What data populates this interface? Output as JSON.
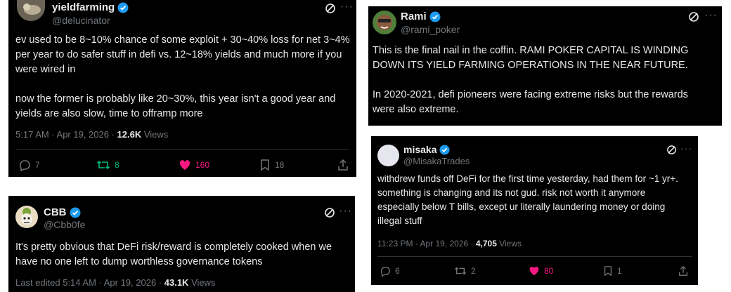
{
  "colors": {
    "background": "#000000",
    "text": "#e7e9ea",
    "muted": "#71767b",
    "verified": "#1d9bf0",
    "retweet": "#00ba7c",
    "like": "#f91880"
  },
  "tweets": [
    {
      "name": "yieldfarming",
      "handle": "@delucinator",
      "paragraphs": [
        "ev used to be 8~10% chance of some exploit + 30~40% loss for net 3~4% per year to do safer stuff in defi vs. 12~18% yields and much more if you were wired in",
        "now the former is probably like 20~30%, this year isn't a good year and yields are also slow, time to offramp more"
      ],
      "time": "5:17 AM · Apr 19, 2026 · ",
      "views_count": "12.6K",
      "views_label": " Views",
      "replies": "7",
      "retweets": "8",
      "likes": "160",
      "bookmarks": "18"
    },
    {
      "name": "CBB",
      "handle": "@Cbb0fe",
      "paragraphs": [
        "It's pretty obvious that DeFi risk/reward is completely cooked when we have no one left to dump worthless governance tokens"
      ],
      "time": "Last edited 5:14 AM · Apr 19, 2026 · ",
      "views_count": "43.1K",
      "views_label": " Views"
    },
    {
      "name": "Rami",
      "handle": "@rami_poker",
      "paragraphs": [
        "This is the final nail in the coffin. RAMI POKER CAPITAL IS WINDING DOWN ITS YIELD FARMING OPERATIONS IN THE NEAR FUTURE.",
        "In 2020-2021, defi pioneers were facing extreme risks but the rewards were also extreme."
      ]
    },
    {
      "name": "misaka",
      "handle": "@MisakaTrades",
      "paragraphs": [
        "withdrew funds off DeFi for the first time yesterday, had them for ~1 yr+. something is changing and its not gud. risk not worth it anymore especially below T bills, except ur literally laundering money or doing illegal stuff"
      ],
      "time": "11:23 PM · Apr 19, 2026 · ",
      "views_count": "4,705",
      "views_label": " Views",
      "replies": "6",
      "retweets": "2",
      "likes": "80",
      "bookmarks": "1"
    }
  ]
}
